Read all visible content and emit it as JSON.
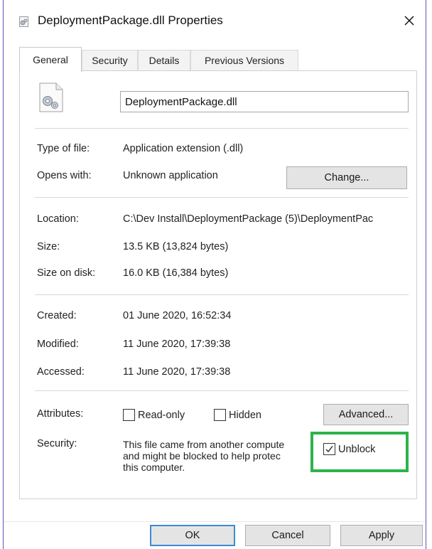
{
  "window": {
    "title": "DeploymentPackage.dll Properties",
    "accent_color": "#3c8ad8",
    "highlight_color": "#2db34a"
  },
  "tabs": [
    {
      "label": "General",
      "active": true
    },
    {
      "label": "Security",
      "active": false
    },
    {
      "label": "Details",
      "active": false
    },
    {
      "label": "Previous Versions",
      "active": false
    }
  ],
  "general": {
    "file_name": "DeploymentPackage.dll",
    "type_of_file_label": "Type of file:",
    "type_of_file_value": "Application extension (.dll)",
    "opens_with_label": "Opens with:",
    "opens_with_value": "Unknown application",
    "change_button": "Change...",
    "location_label": "Location:",
    "location_value": "C:\\Dev Install\\DeploymentPackage (5)\\DeploymentPac",
    "size_label": "Size:",
    "size_value": "13.5 KB (13,824 bytes)",
    "size_on_disk_label": "Size on disk:",
    "size_on_disk_value": "16.0 KB (16,384 bytes)",
    "created_label": "Created:",
    "created_value": "01 June 2020, 16:52:34",
    "modified_label": "Modified:",
    "modified_value": "11 June 2020, 17:39:38",
    "accessed_label": "Accessed:",
    "accessed_value": "11 June 2020, 17:39:38",
    "attributes_label": "Attributes:",
    "readonly_label": "Read-only",
    "readonly_checked": false,
    "hidden_label": "Hidden",
    "hidden_checked": false,
    "advanced_button": "Advanced...",
    "security_label": "Security:",
    "security_text_lines": [
      "This file came from another compute",
      "and might be blocked to help protec",
      "this computer."
    ],
    "unblock_label": "Unblock",
    "unblock_checked": true
  },
  "footer": {
    "ok_button": "OK",
    "cancel_button": "Cancel",
    "apply_button": "Apply"
  }
}
